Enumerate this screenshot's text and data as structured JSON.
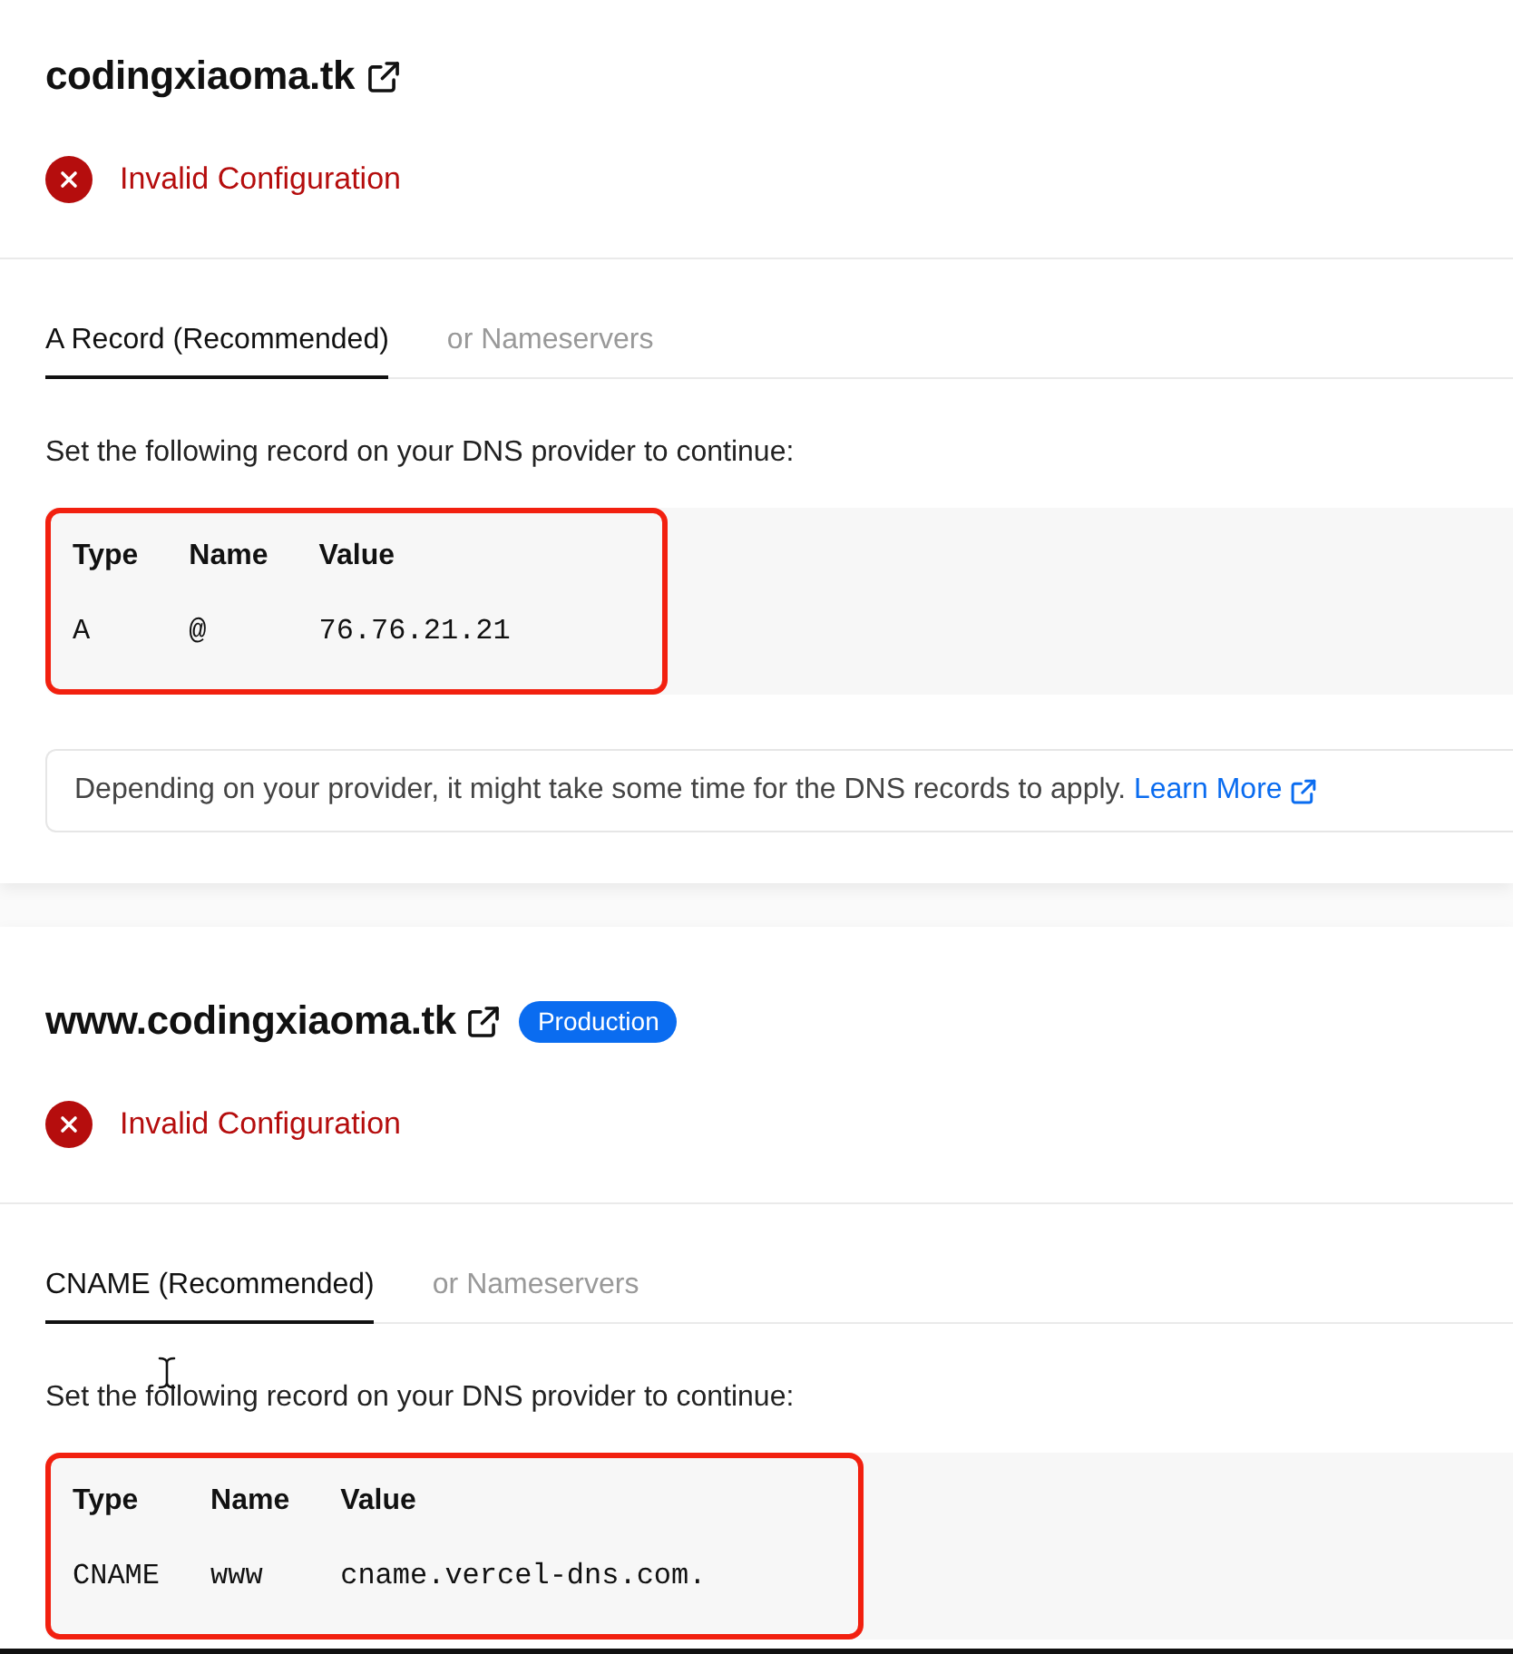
{
  "domains": [
    {
      "name": "codingxiaoma.tk",
      "status": {
        "kind": "error",
        "text": "Invalid Configuration"
      },
      "tabs": [
        {
          "label": "A Record (Recommended)",
          "selected": true
        },
        {
          "label": "or Nameservers",
          "selected": false
        }
      ],
      "instruction": "Set the following record on your DNS provider to continue:",
      "record": {
        "highlighted": true,
        "columns": [
          "Type",
          "Name",
          "Value"
        ],
        "rows": [
          [
            "A",
            "@",
            "76.76.21.21"
          ]
        ]
      },
      "note": {
        "text": "Depending on your provider, it might take some time for the DNS records to apply.",
        "link": "Learn More"
      }
    },
    {
      "name": "www.codingxiaoma.tk",
      "badge": "Production",
      "status": {
        "kind": "error",
        "text": "Invalid Configuration"
      },
      "tabs": [
        {
          "label": "CNAME (Recommended)",
          "selected": true
        },
        {
          "label": "or Nameservers",
          "selected": false
        }
      ],
      "instruction": "Set the following record on your DNS provider to continue:",
      "text_cursor_shown": true,
      "record": {
        "highlighted": true,
        "columns": [
          "Type",
          "Name",
          "Value"
        ],
        "rows": [
          [
            "CNAME",
            "www",
            "cname.vercel-dns.com."
          ]
        ]
      }
    }
  ]
}
